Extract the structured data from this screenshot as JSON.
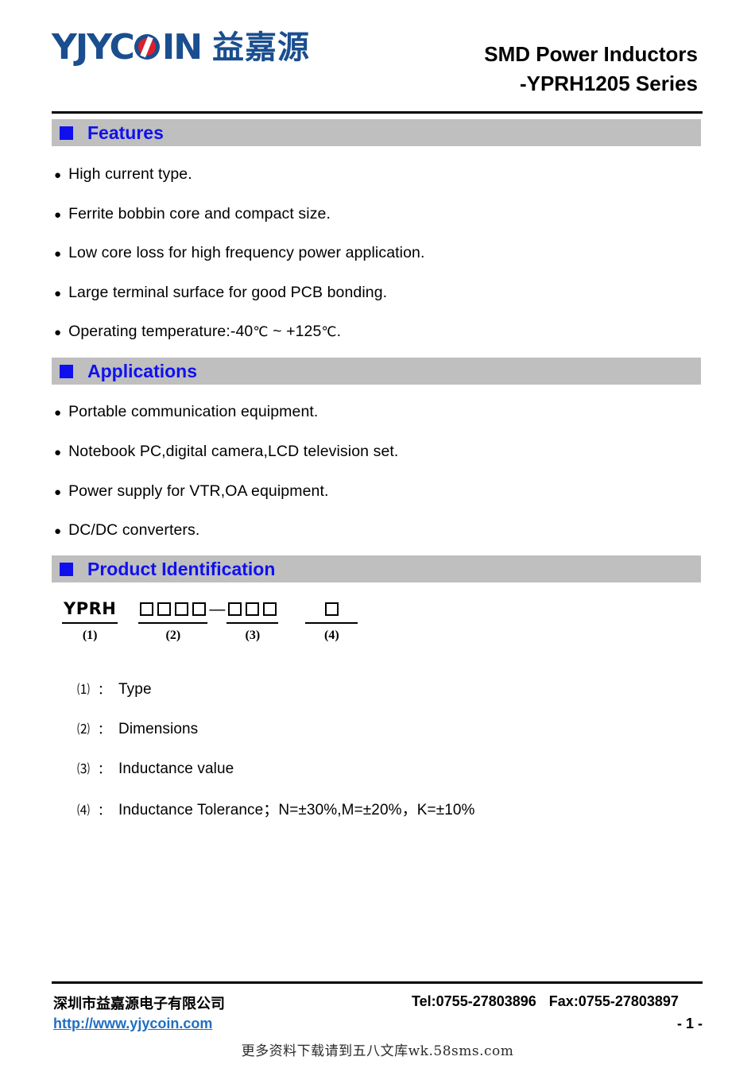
{
  "header": {
    "logo": {
      "wordmark_pre": "YJYC",
      "wordmark_o": "O",
      "wordmark_post": "IN",
      "chinese": "益嘉源",
      "brand_color": "#1A4E8F",
      "accent_color": "#D8202F"
    },
    "title_line1": "SMD Power Inductors",
    "title_line2": "-YPRH1205 Series"
  },
  "sections": {
    "features": {
      "band_label": "Features",
      "items": [
        "High current type.",
        "Ferrite bobbin core and compact size.",
        "Low core loss for high frequency power application.",
        "Large terminal surface for good PCB bonding."
      ],
      "temperature_item": {
        "prefix": "Operating temperature:-40",
        "unit1": "℃",
        "middle": " ~ +125",
        "unit2": "℃",
        "suffix": "."
      }
    },
    "applications": {
      "band_label": "Applications",
      "items": [
        "Portable communication equipment.",
        "Notebook PC,digital camera,LCD television set.",
        "Power supply for VTR,OA equipment.",
        "DC/DC converters."
      ]
    },
    "product_identification": {
      "band_label": "Product Identification",
      "diagram": {
        "groups": [
          {
            "kind": "text",
            "value": "YPRH",
            "index": "(1)"
          },
          {
            "kind": "boxes",
            "count": 4,
            "index": "(2)"
          },
          {
            "kind": "boxes",
            "count": 3,
            "index": "(3)"
          },
          {
            "kind": "boxes",
            "count": 1,
            "index": "(4)"
          }
        ],
        "separator": "—"
      },
      "legend": [
        {
          "num": "⑴",
          "colon": "：",
          "text": "Type"
        },
        {
          "num": "⑵",
          "colon": "：",
          "text": "Dimensions"
        },
        {
          "num": "⑶",
          "colon": "：",
          "text": "Inductance value"
        },
        {
          "num": "⑷",
          "colon": "：",
          "text": "Inductance Tolerance；N=±30%,M=±20%，K=±10%"
        }
      ]
    }
  },
  "band_colors": {
    "background": "#BFBFBF",
    "text": "#1010EE"
  },
  "footer": {
    "company": "深圳市益嘉源电子有限公司",
    "url": "http://www.yjycoin.com",
    "tel": "Tel:0755-27803896",
    "fax": "Fax:0755-27803897",
    "page": "- 1 -",
    "watermark": "更多资料下载请到五八文库wk.58sms.com"
  },
  "bullet_glyph": "●"
}
